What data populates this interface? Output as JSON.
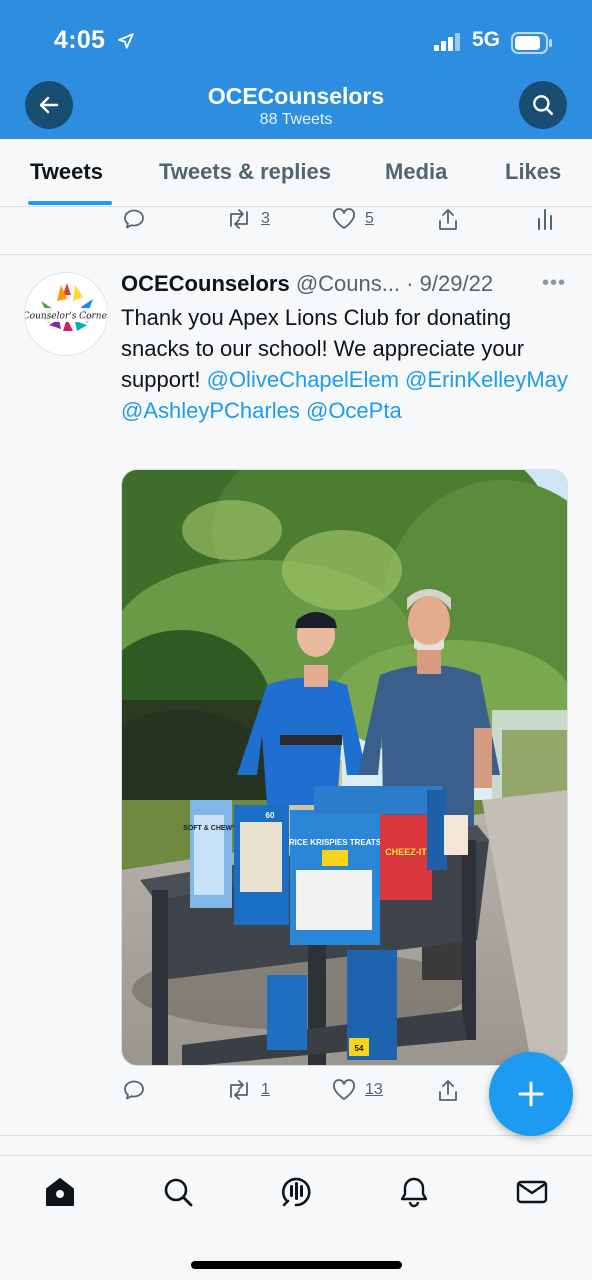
{
  "status_bar": {
    "time": "4:05",
    "network": "5G"
  },
  "header": {
    "title": "OCECounselors",
    "subtitle": "88 Tweets"
  },
  "tabs": [
    {
      "label": "Tweets",
      "active": true
    },
    {
      "label": "Tweets & replies",
      "active": false
    },
    {
      "label": "Media",
      "active": false
    },
    {
      "label": "Likes",
      "active": false
    }
  ],
  "previous_tweet_actions": {
    "retweets": "3",
    "likes": "5"
  },
  "tweet": {
    "author_name": "OCECounselors",
    "author_handle": "@Couns...",
    "separator": " · ",
    "date": "9/29/22",
    "avatar_text": "Counselor's Corner",
    "text": "Thank you Apex Lions Club for donating snacks to our school! We appreciate your support! ",
    "mentions": [
      "@OliveChapelElem",
      "@ErinKelleyMay",
      "@AshleyPCharles",
      "@OcePta"
    ],
    "retweets": "1",
    "likes": "13"
  },
  "image_labels": {
    "box1": "SOFT & CHEWY",
    "box2": "RICE KRISPIES TREATS",
    "box2_count": "60",
    "box3": "CHEEZ-IT",
    "box4_count": "54"
  },
  "icons": {
    "back": "arrow-left-icon",
    "search": "search-icon",
    "reply": "reply-icon",
    "retweet": "retweet-icon",
    "like": "heart-icon",
    "share": "share-icon",
    "analytics": "analytics-icon",
    "compose": "plus-icon",
    "home": "home-icon",
    "explore": "search-icon",
    "spaces": "spaces-icon",
    "notifications": "bell-icon",
    "messages": "mail-icon"
  },
  "colors": {
    "header_bg": "#2d8ee0",
    "accent": "#1d9bf0",
    "text": "#0f1419",
    "muted": "#536471"
  }
}
